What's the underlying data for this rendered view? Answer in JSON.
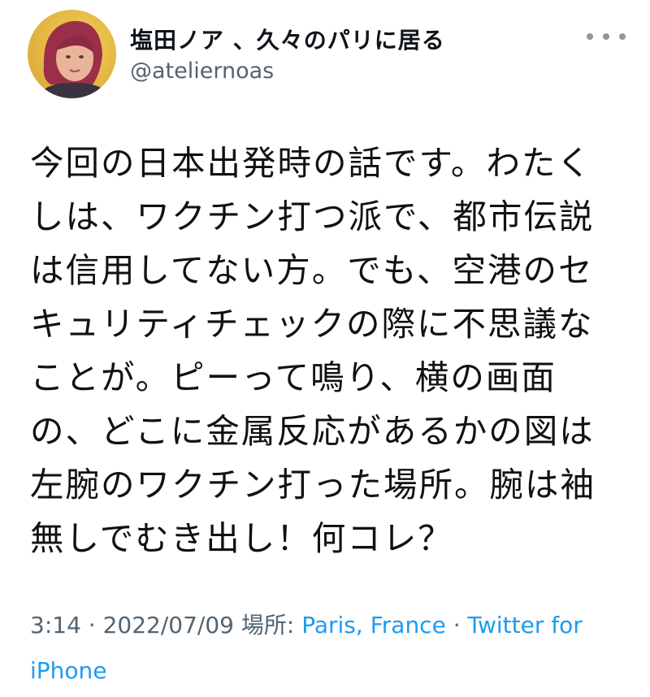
{
  "author": {
    "display_name": "塩田ノア 、久々のパリに居る",
    "handle": "@ateliernoas"
  },
  "tweet": {
    "lines": [
      "今回の日本出発時の話です。わたく",
      "しは、ワクチン打つ派で、都市伝説",
      "は信用してない方。でも、空港のセ",
      "キュリティチェックの際に不思議な",
      "ことが。ピーって鳴り、横の画面",
      "の、どこに金属反応があるかの図は",
      "左腕のワクチン打った場所。腕は袖",
      "無しでむき出し！何コレ？"
    ]
  },
  "meta": {
    "time": "3:14",
    "sep1": " · ",
    "date": "2022/07/09",
    "location_label": " 場所: ",
    "location": "Paris, France",
    "sep2": " · ",
    "source": "Twitter for iPhone"
  },
  "icons": {
    "more": "more-options-icon",
    "avatar": "avatar"
  },
  "colors": {
    "link": "#1d9bf0",
    "muted": "#536471",
    "text": "#111111"
  }
}
